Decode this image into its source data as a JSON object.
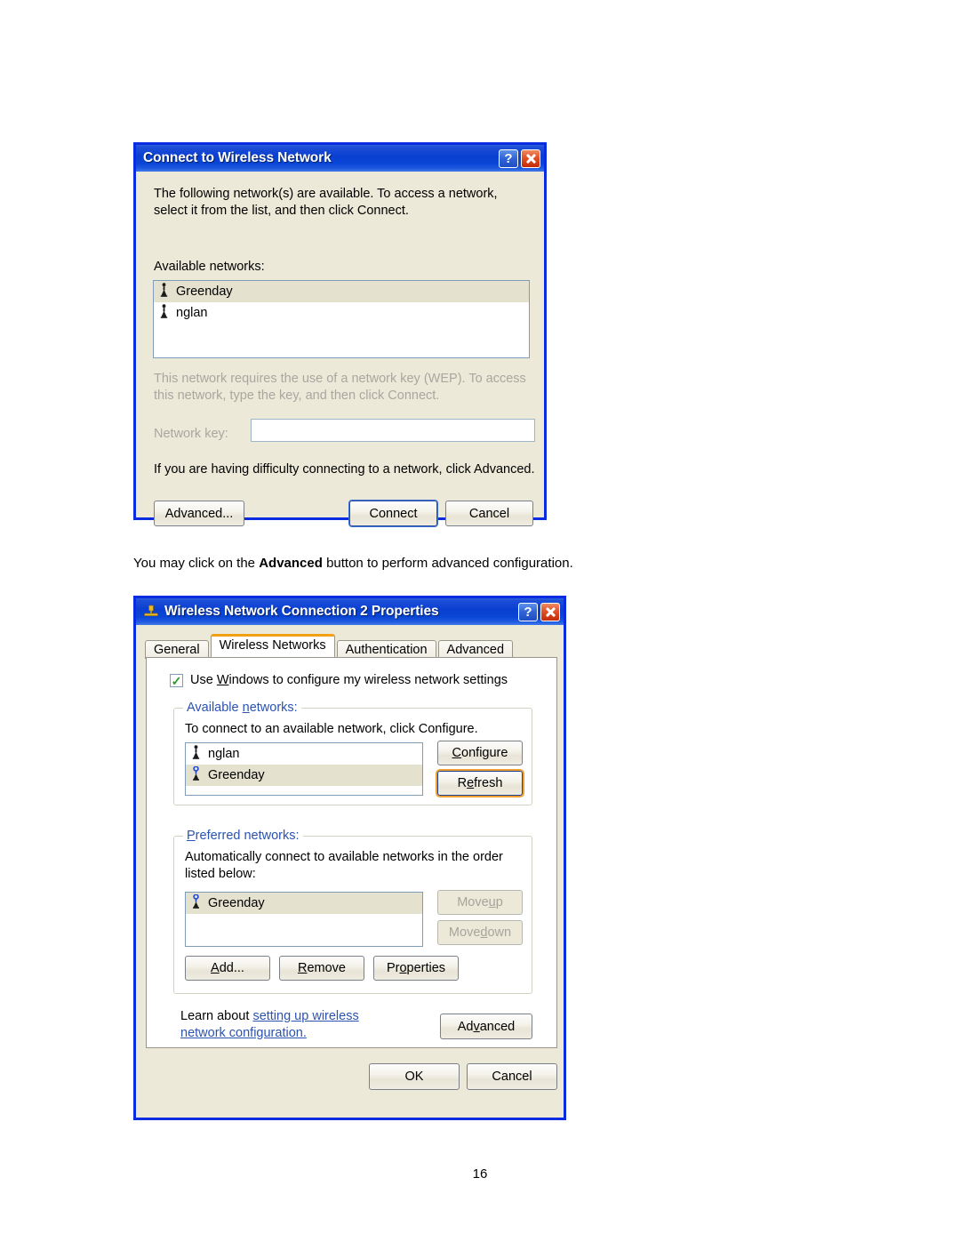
{
  "page": {
    "number": "16"
  },
  "caption": {
    "before": "You may click on the ",
    "bold": "Advanced",
    "after": " button to perform advanced configuration."
  },
  "dialog1": {
    "title": "Connect to Wireless Network",
    "help_label": "?",
    "close_label": "Close",
    "intro": "The following network(s) are available. To access a network, select it from the list, and then click Connect.",
    "available_label": "Available networks:",
    "networks": [
      {
        "name": "Greenday",
        "icon": "wireless-tower-icon",
        "selected": true
      },
      {
        "name": "nglan",
        "icon": "wireless-tower-icon",
        "selected": false
      }
    ],
    "wep_note": "This network requires the use of a network key (WEP). To access this network, type the key, and then click Connect.",
    "network_key_label": "Network key:",
    "network_key_value": "",
    "difficulty_note": "If you are having difficulty connecting to a network, click Advanced.",
    "buttons": {
      "advanced": "Advanced...",
      "connect": "Connect",
      "cancel": "Cancel"
    }
  },
  "dialog2": {
    "title": "Wireless Network Connection 2 Properties",
    "title_icon": "network-adapter-icon",
    "help_label": "?",
    "tabs": [
      {
        "label": "General",
        "active": false
      },
      {
        "label": "Wireless Networks",
        "active": true
      },
      {
        "label": "Authentication",
        "active": false
      },
      {
        "label": "Advanced",
        "active": false
      }
    ],
    "use_windows_checkbox": {
      "checked": true,
      "label_pre": "Use ",
      "label_accel": "W",
      "label_post": "indows to configure my wireless network settings"
    },
    "available_group": {
      "label_accel": "n",
      "label_pre": "Available ",
      "label_post": "etworks:",
      "hint": "To connect to an available network, click Configure.",
      "networks": [
        {
          "name": "nglan",
          "icon": "wireless-tower-icon",
          "selected": false,
          "preferred": false
        },
        {
          "name": "Greenday",
          "icon": "wireless-tower-preferred-icon",
          "selected": true,
          "preferred": true
        }
      ],
      "configure_button": {
        "accel": "C",
        "rest": "onfigure"
      },
      "refresh_button": {
        "pre": "R",
        "accel": "e",
        "rest": "fresh"
      }
    },
    "preferred_group": {
      "label_accel": "P",
      "label_post": "referred networks:",
      "hint": "Automatically connect to available networks in the order listed below:",
      "networks": [
        {
          "name": "Greenday",
          "icon": "wireless-tower-preferred-icon",
          "selected": true
        }
      ],
      "move_up": {
        "pre": "Move ",
        "accel": "u",
        "rest": "p",
        "disabled": true
      },
      "move_down": {
        "pre": "Move ",
        "accel": "d",
        "rest": "own",
        "disabled": true
      },
      "add_button": {
        "accel": "A",
        "rest": "dd..."
      },
      "remove_button": {
        "accel": "R",
        "rest": "emove"
      },
      "properties_button": {
        "pre": "Pr",
        "accel": "o",
        "rest": "perties"
      }
    },
    "learn": {
      "prefix": "Learn about ",
      "link": "setting up wireless network configuration."
    },
    "advanced_button": {
      "pre": "Ad",
      "accel": "v",
      "rest": "anced"
    },
    "ok_button": "OK",
    "cancel_button": "Cancel"
  },
  "colors": {
    "title_blue": "#0a3fd0",
    "dialog_face": "#ece9d8",
    "selection": "#e4e1ce",
    "group_label": "#2b53b0",
    "focus_orange": "#f3a017",
    "link": "#2b53b0"
  }
}
